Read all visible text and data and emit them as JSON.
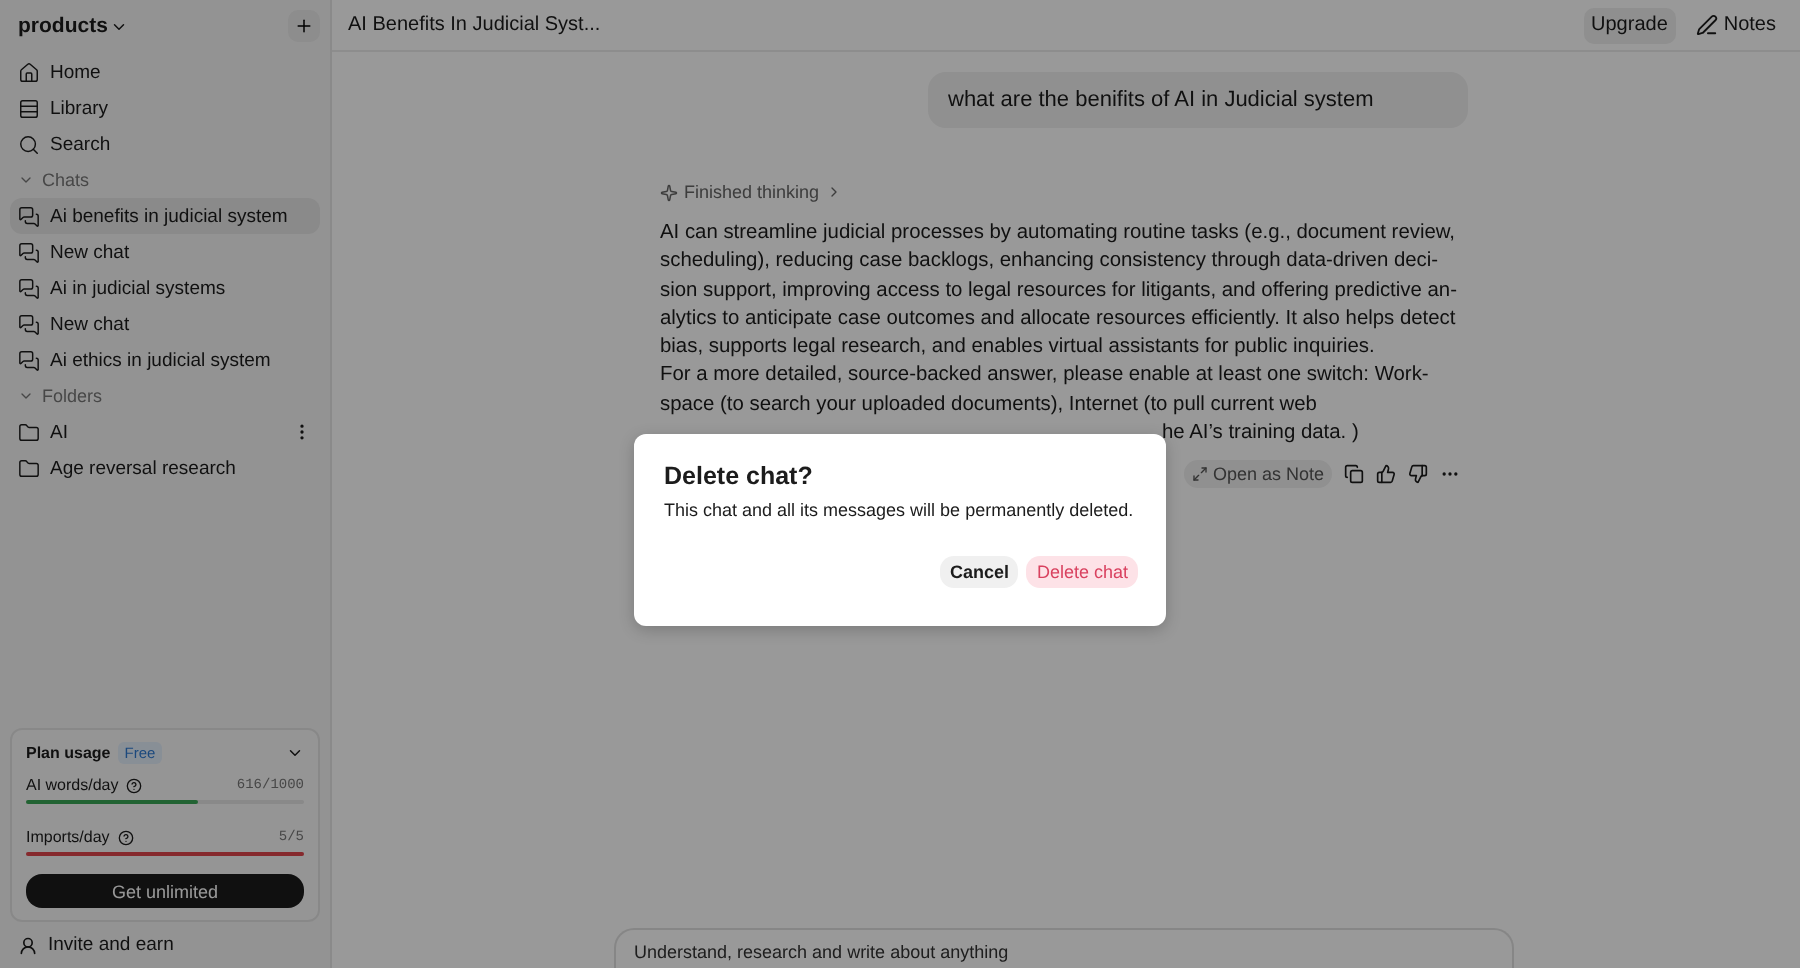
{
  "sidebar": {
    "workspace": "products",
    "nav": [
      {
        "label": "Home",
        "kind": "home"
      },
      {
        "label": "Library",
        "kind": "library"
      },
      {
        "label": "Search",
        "kind": "search"
      }
    ],
    "sections": [
      {
        "title": "Chats",
        "expanded": true,
        "kind": "chat",
        "items": [
          {
            "label": "Ai benefits in judicial system",
            "selected": true
          },
          {
            "label": "New chat",
            "selected": false
          },
          {
            "label": "Ai in judicial systems",
            "selected": false
          },
          {
            "label": "New chat",
            "selected": false
          },
          {
            "label": "Ai ethics in judicial system",
            "selected": false
          }
        ]
      },
      {
        "title": "Folders",
        "expanded": true,
        "kind": "folder",
        "items": [
          {
            "label": "AI",
            "selected": false,
            "menu": true
          },
          {
            "label": "Age reversal research",
            "selected": false,
            "menu": false
          }
        ]
      }
    ],
    "plan": {
      "title": "Plan usage",
      "badge": "Free",
      "meters": [
        {
          "label": "AI words/day",
          "reading": "616/1000",
          "level": 0.616,
          "kind": "normal"
        },
        {
          "label": "Imports/day",
          "reading": "5/5",
          "level": 1,
          "kind": "limit"
        }
      ],
      "button": "Get unlimited"
    },
    "footer": "Invite and earn"
  },
  "topbar": {
    "title": "AI Benefits In Judicial Syst...",
    "upgrade": "Upgrade",
    "notes": "Notes"
  },
  "chat": {
    "user_message": "what are the benifits of AI in Judicial system",
    "thinking": "Finished thinking",
    "answer_lines": [
      "AI can streamline judicial processes by automating routine tasks (e.g., document review,",
      "scheduling), reducing case backlogs, enhancing consistency through data-driven deci-",
      "sion support, improving access to legal resources for litigants, and offering predictive an-",
      "alytics to anticipate case outcomes and allocate resources efficiently. It also helps detect",
      "bias, supports legal research, and enables virtual assistants for public inquiries.",
      "For a more detailed, source-backed answer, please enable at least one switch: Work-",
      "space (to search your uploaded documents), Internet (to pull current web"
    ],
    "answer_tail": "he AI’s training data. )",
    "open_note": "Open as Note"
  },
  "composer": {
    "placeholder": "Understand, research and write about anything"
  },
  "dialog": {
    "title": "Delete chat?",
    "body": "This chat and all its messages will be permanently deleted.",
    "buttons": [
      {
        "label": "Cancel",
        "kind": "secondary"
      },
      {
        "label": "Delete chat",
        "kind": "danger"
      }
    ]
  }
}
